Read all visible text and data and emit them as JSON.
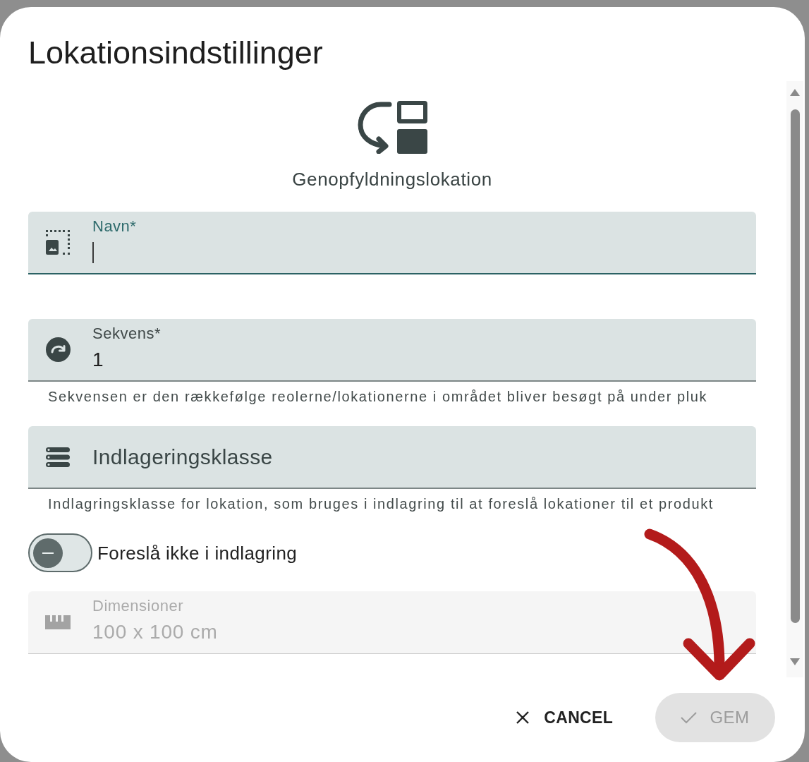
{
  "dialog": {
    "title": "Lokationsindstillinger"
  },
  "location_type": {
    "label": "Genopfyldningslokation"
  },
  "form": [
    {
      "kind": "text",
      "label": "Navn*",
      "focused": true,
      "disabled": false
    },
    {
      "kind": "text",
      "label": "Sekvens*",
      "value": "1",
      "helper": "Sekvensen er den rækkefølge reolerne/lokationerne i området bliver besøgt på under pluk",
      "focused": false,
      "disabled": false
    },
    {
      "kind": "select",
      "label": "Indlageringsklasse",
      "helper": "Indlagringsklasse for lokation, som bruges i indlagring til at foreslå lokationer til et produkt",
      "focused": false,
      "disabled": false
    },
    {
      "kind": "toggle",
      "label": "Foreslå ikke i indlagring",
      "on": false,
      "focused": false,
      "disabled": false
    },
    {
      "kind": "text",
      "label": "Dimensioner",
      "value": "100 x 100 cm",
      "focused": false,
      "disabled": true
    }
  ],
  "buttons": [
    {
      "kind": "cancel",
      "label": "CANCEL",
      "disabled": false
    },
    {
      "kind": "confirm",
      "label": "GEM",
      "disabled": true
    }
  ]
}
